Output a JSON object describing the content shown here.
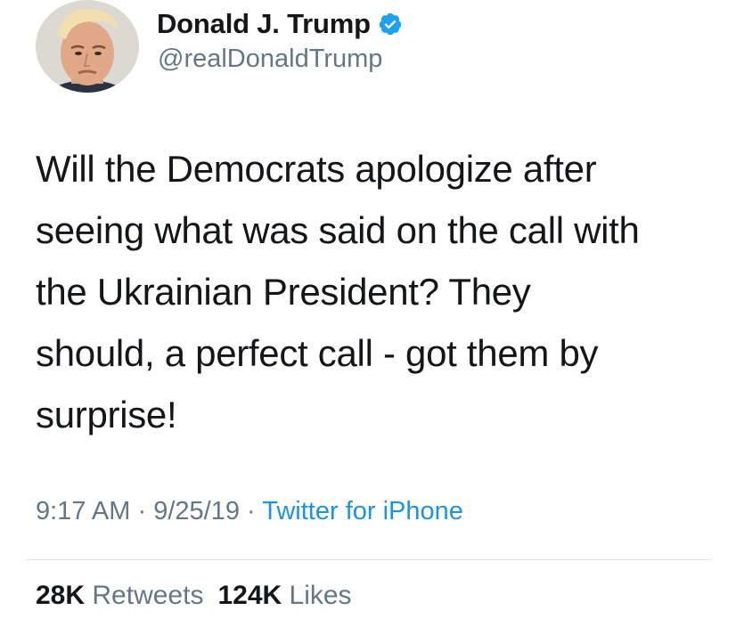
{
  "author": {
    "display_name": "Donald J. Trump",
    "handle": "@realDonaldTrump",
    "verified_icon": "verified-badge-icon",
    "avatar_icon": "profile-photo"
  },
  "tweet": {
    "lines": [
      "Will the Democrats apologize after",
      "seeing what was said on the call with",
      "the Ukrainian President? They",
      "should, a perfect call - got them by",
      "surprise!"
    ]
  },
  "meta": {
    "time": "9:17 AM",
    "separator": "·",
    "date": "9/25/19",
    "source": "Twitter for iPhone"
  },
  "stats": {
    "retweets_count": "28K",
    "retweets_label": "Retweets",
    "likes_count": "124K",
    "likes_label": "Likes"
  },
  "colors": {
    "text": "#14171a",
    "secondary": "#657786",
    "link": "#1b95e0",
    "verified": "#1da1f2",
    "divider": "#e1e8ed"
  }
}
